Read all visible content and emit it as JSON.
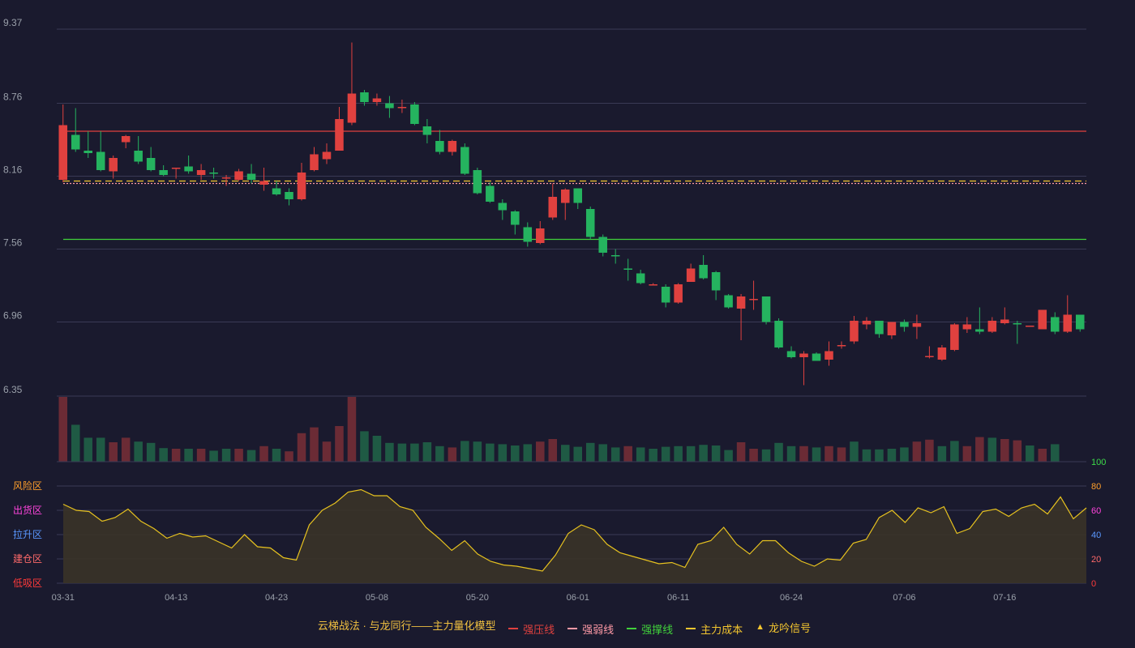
{
  "chart_data": {
    "type": "candlestick",
    "x": [
      "03-31",
      "04-01",
      "04-02",
      "04-03",
      "04-07",
      "04-08",
      "04-09",
      "04-10",
      "04-11",
      "04-13",
      "04-14",
      "04-15",
      "04-16",
      "04-17",
      "04-18",
      "04-21",
      "04-22",
      "04-23",
      "04-24",
      "04-25",
      "04-28",
      "04-29",
      "04-30",
      "05-06",
      "05-07",
      "05-08",
      "05-09",
      "05-12",
      "05-13",
      "05-14",
      "05-15",
      "05-16",
      "05-19",
      "05-20",
      "05-21",
      "05-22",
      "05-23",
      "05-26",
      "05-27",
      "05-28",
      "05-29",
      "06-01",
      "06-02",
      "06-03",
      "06-04",
      "06-05",
      "06-06",
      "06-09",
      "06-10",
      "06-11",
      "06-12",
      "06-13",
      "06-16",
      "06-17",
      "06-18",
      "06-19",
      "06-20",
      "06-23",
      "06-24",
      "06-25",
      "06-26",
      "06-27",
      "06-30",
      "07-01",
      "07-02",
      "07-03",
      "07-04",
      "07-06",
      "07-07",
      "07-08",
      "07-09",
      "07-10",
      "07-11",
      "07-14",
      "07-15",
      "07-16",
      "07-17",
      "07-18",
      "07-21",
      "07-22",
      "07-23",
      "07-24"
    ],
    "candles": [
      [
        8.13,
        8.58,
        8.11,
        8.75
      ],
      [
        8.5,
        8.38,
        8.36,
        8.72
      ],
      [
        8.37,
        8.35,
        8.31,
        8.53
      ],
      [
        8.36,
        8.21,
        8.2,
        8.53
      ],
      [
        8.2,
        8.31,
        8.14,
        8.33
      ],
      [
        8.44,
        8.49,
        8.39,
        8.5
      ],
      [
        8.37,
        8.28,
        8.26,
        8.49
      ],
      [
        8.31,
        8.21,
        8.2,
        8.4
      ],
      [
        8.21,
        8.17,
        8.16,
        8.25
      ],
      [
        8.22,
        8.23,
        8.14,
        8.23
      ],
      [
        8.24,
        8.2,
        8.18,
        8.33
      ],
      [
        8.17,
        8.21,
        8.13,
        8.26
      ],
      [
        8.19,
        8.18,
        8.14,
        8.23
      ],
      [
        8.14,
        8.15,
        8.08,
        8.17
      ],
      [
        8.13,
        8.2,
        8.12,
        8.22
      ],
      [
        8.18,
        8.13,
        8.1,
        8.26
      ],
      [
        8.09,
        8.12,
        8.04,
        8.23
      ],
      [
        8.06,
        8.01,
        8.0,
        8.12
      ],
      [
        8.03,
        7.97,
        7.92,
        8.06
      ],
      [
        7.97,
        8.19,
        7.96,
        8.27
      ],
      [
        8.21,
        8.34,
        8.2,
        8.4
      ],
      [
        8.3,
        8.36,
        8.26,
        8.43
      ],
      [
        8.37,
        8.63,
        8.37,
        8.73
      ],
      [
        8.6,
        8.84,
        8.58,
        9.26
      ],
      [
        8.85,
        8.77,
        8.74,
        8.87
      ],
      [
        8.77,
        8.8,
        8.74,
        8.84
      ],
      [
        8.76,
        8.72,
        8.64,
        8.82
      ],
      [
        8.73,
        8.73,
        8.68,
        8.79
      ],
      [
        8.75,
        8.59,
        8.58,
        8.77
      ],
      [
        8.57,
        8.5,
        8.43,
        8.63
      ],
      [
        8.45,
        8.36,
        8.34,
        8.54
      ],
      [
        8.36,
        8.45,
        8.33,
        8.46
      ],
      [
        8.4,
        8.18,
        8.17,
        8.43
      ],
      [
        8.21,
        8.02,
        8.01,
        8.23
      ],
      [
        8.08,
        7.95,
        7.94,
        8.11
      ],
      [
        7.94,
        7.88,
        7.8,
        7.97
      ],
      [
        7.87,
        7.76,
        7.68,
        7.88
      ],
      [
        7.74,
        7.62,
        7.58,
        7.78
      ],
      [
        7.61,
        7.73,
        7.6,
        7.79
      ],
      [
        7.82,
        7.99,
        7.8,
        8.1
      ],
      [
        7.94,
        8.05,
        7.8,
        8.06
      ],
      [
        8.06,
        7.94,
        7.89,
        8.06
      ],
      [
        7.89,
        7.66,
        7.64,
        7.91
      ],
      [
        7.66,
        7.53,
        7.5,
        7.68
      ],
      [
        7.51,
        7.5,
        7.44,
        7.56
      ],
      [
        7.4,
        7.39,
        7.3,
        7.48
      ],
      [
        7.36,
        7.28,
        7.27,
        7.39
      ],
      [
        7.27,
        7.27,
        7.26,
        7.28
      ],
      [
        7.25,
        7.12,
        7.08,
        7.27
      ],
      [
        7.12,
        7.27,
        7.11,
        7.28
      ],
      [
        7.29,
        7.4,
        7.32,
        7.44
      ],
      [
        7.43,
        7.32,
        7.31,
        7.51
      ],
      [
        7.37,
        7.22,
        7.14,
        7.38
      ],
      [
        7.18,
        7.08,
        7.07,
        7.19
      ],
      [
        7.07,
        7.17,
        6.81,
        7.19
      ],
      [
        7.15,
        7.15,
        7.06,
        7.3
      ],
      [
        7.17,
        6.96,
        6.94,
        7.17
      ],
      [
        6.97,
        6.75,
        6.74,
        6.99
      ],
      [
        6.72,
        6.67,
        6.66,
        6.76
      ],
      [
        6.67,
        6.7,
        6.44,
        6.72
      ],
      [
        6.7,
        6.64,
        6.64,
        6.71
      ],
      [
        6.65,
        6.72,
        6.6,
        6.8
      ],
      [
        6.76,
        6.77,
        6.74,
        6.8
      ],
      [
        6.8,
        6.97,
        6.78,
        7.01
      ],
      [
        6.94,
        6.97,
        6.9,
        7.0
      ],
      [
        6.97,
        6.86,
        6.83,
        6.97
      ],
      [
        6.85,
        6.96,
        6.82,
        6.96
      ],
      [
        6.96,
        6.92,
        6.88,
        6.98
      ],
      [
        6.92,
        6.95,
        6.82,
        7.02
      ],
      [
        6.68,
        6.68,
        6.66,
        6.76
      ],
      [
        6.65,
        6.75,
        6.64,
        6.77
      ],
      [
        6.73,
        6.94,
        6.72,
        6.95
      ],
      [
        6.9,
        6.94,
        6.87,
        7.0
      ],
      [
        6.9,
        6.88,
        6.86,
        7.08
      ],
      [
        6.88,
        6.97,
        6.87,
        7.0
      ],
      [
        6.95,
        6.98,
        6.94,
        7.08
      ],
      [
        6.95,
        6.94,
        6.78,
        6.97
      ],
      [
        6.93,
        6.93,
        6.93,
        6.93
      ],
      [
        6.9,
        7.06,
        6.9,
        7.06
      ],
      [
        7.0,
        6.88,
        6.86,
        7.04
      ],
      [
        6.88,
        7.02,
        6.87,
        7.18
      ],
      [
        7.02,
        6.9,
        6.88,
        7.02
      ]
    ],
    "volume_levels": [
      100,
      57,
      37,
      37,
      30,
      37,
      31,
      29,
      21,
      20,
      20,
      20,
      17,
      20,
      20,
      18,
      24,
      20,
      16,
      44,
      53,
      31,
      55,
      100,
      47,
      40,
      29,
      28,
      28,
      30,
      24,
      22,
      32,
      31,
      28,
      27,
      25,
      27,
      31,
      35,
      26,
      23,
      29,
      27,
      22,
      24,
      22,
      20,
      23,
      24,
      24,
      26,
      25,
      18,
      30,
      20,
      19,
      29,
      24,
      24,
      22,
      24,
      22,
      31,
      19,
      19,
      20,
      22,
      31,
      34,
      24,
      32,
      24,
      38,
      37,
      35,
      33,
      25,
      20,
      27
    ],
    "volume_colors": [
      "up",
      "down",
      "down",
      "down",
      "up",
      "up",
      "down",
      "down",
      "down",
      "up",
      "down",
      "up",
      "down",
      "down",
      "up",
      "down",
      "up",
      "down",
      "up",
      "up",
      "up",
      "up",
      "up",
      "up",
      "down",
      "down",
      "down",
      "down",
      "down",
      "down",
      "down",
      "up",
      "down",
      "down",
      "down",
      "down",
      "down",
      "down",
      "up",
      "up",
      "down",
      "down",
      "down",
      "down",
      "down",
      "up",
      "down",
      "down",
      "down",
      "down",
      "down",
      "down",
      "down",
      "down",
      "up",
      "up",
      "down",
      "down",
      "down",
      "up",
      "down",
      "up",
      "up",
      "down",
      "down",
      "down",
      "down",
      "down",
      "up",
      "up",
      "down",
      "down",
      "up",
      "up",
      "down",
      "up",
      "up",
      "down",
      "up",
      "down",
      "up",
      "up"
    ],
    "oscillator": [
      65,
      60,
      59,
      51,
      54,
      61,
      51,
      45,
      37,
      41,
      38,
      39,
      34,
      29,
      40,
      30,
      29,
      21,
      19,
      48,
      60,
      66,
      75,
      77,
      72,
      72,
      63,
      60,
      46,
      37,
      27,
      35,
      24,
      18,
      15,
      14,
      12,
      10,
      23,
      41,
      48,
      44,
      32,
      25,
      22,
      19,
      16,
      17,
      13,
      32,
      35,
      46,
      32,
      24,
      35,
      35,
      25,
      18,
      14,
      20,
      19,
      33,
      36,
      54,
      60,
      50,
      62,
      58,
      63,
      41,
      45,
      59,
      61,
      55,
      62,
      65,
      57,
      71,
      53,
      62
    ],
    "y_axis_ticks": [
      "9.37",
      "8.76",
      "8.16",
      "7.56",
      "6.96",
      "6.35"
    ],
    "x_axis_ticks": [
      "03-31",
      "04-13",
      "04-23",
      "05-08",
      "05-20",
      "06-01",
      "06-11",
      "06-24",
      "07-06",
      "07-16"
    ],
    "osc_axis_right": [
      "100",
      "80",
      "60",
      "40",
      "20",
      "0"
    ],
    "osc_axis_left": [
      "风险区",
      "出货区",
      "拉升区",
      "建仓区",
      "低吸区"
    ],
    "price_range": [
      6.35,
      9.37
    ],
    "osc_range": [
      0,
      100
    ],
    "lines": [
      {
        "name": "强压线",
        "value": 8.53,
        "color": "#e0413f",
        "style": "solid"
      },
      {
        "name": "强弱线",
        "value": 8.1,
        "color": "#ff9aa6",
        "style": "dotted"
      },
      {
        "name": "强撑线",
        "value": 7.64,
        "color": "#41d13b",
        "style": "solid"
      },
      {
        "name": "主力成本",
        "value": 8.12,
        "color": "#f4c62f",
        "style": "dashed"
      }
    ],
    "legend_title": "云梯战法 · 与龙同行——主力量化模型",
    "legend": [
      {
        "label": "强压线",
        "color": "#e0413f",
        "kind": "line"
      },
      {
        "label": "强弱线",
        "color": "#ff9aa6",
        "kind": "dash"
      },
      {
        "label": "强撑线",
        "color": "#41d13b",
        "kind": "line"
      },
      {
        "label": "主力成本",
        "color": "#f4c62f",
        "kind": "dash"
      },
      {
        "label": "龙吟信号",
        "color": "#f4c62f",
        "kind": "triangle"
      }
    ],
    "colors": {
      "up": "#e0413f",
      "down": "#25b35f",
      "grid": "#3a3a55",
      "axis": "#9aa0aa",
      "vol_up": "#6b2b35",
      "vol_down": "#1f5a44",
      "osc": "#e7c21f",
      "osc_fill": "#3a3328",
      "osc_axis": [
        "#ff9f2b",
        "#ff44dd",
        "#5a98ff",
        "#ff6a6a",
        "#ff3a3a"
      ],
      "osc_right": [
        "#3ddc4a",
        "#ff9f2b",
        "#ff44dd",
        "#5a98ff",
        "#ff6a6a",
        "#ff3a3a"
      ]
    }
  }
}
